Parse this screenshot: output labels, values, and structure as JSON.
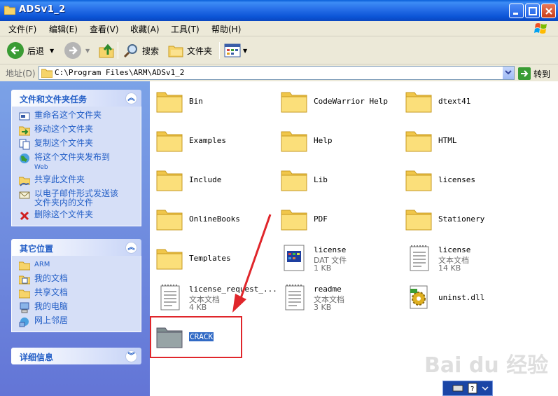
{
  "window": {
    "title": "ADSv1_2"
  },
  "menu": [
    "文件(F)",
    "编辑(E)",
    "查看(V)",
    "收藏(A)",
    "工具(T)",
    "帮助(H)"
  ],
  "toolbar": {
    "back": "后退",
    "search": "搜索",
    "folders": "文件夹"
  },
  "address": {
    "label": "地址(D)",
    "path": "C:\\Program Files\\ARM\\ADSv1_2",
    "go": "转到"
  },
  "tasks_panel": {
    "title": "文件和文件夹任务",
    "items": [
      {
        "label": "重命名这个文件夹"
      },
      {
        "label": "移动这个文件夹"
      },
      {
        "label": "复制这个文件夹"
      },
      {
        "label": "将这个文件夹发布到",
        "label2": "Web"
      },
      {
        "label": "共享此文件夹"
      },
      {
        "label": "以电子邮件形式发送该",
        "label2": "文件夹内的文件"
      },
      {
        "label": "删除这个文件夹"
      }
    ]
  },
  "places_panel": {
    "title": "其它位置",
    "items": [
      "ARM",
      "我的文档",
      "共享文档",
      "我的电脑",
      "网上邻居"
    ]
  },
  "details_panel": {
    "title": "详细信息"
  },
  "files": [
    {
      "name": "Bin",
      "type": "folder"
    },
    {
      "name": "CodeWarrior Help",
      "type": "folder"
    },
    {
      "name": "dtext41",
      "type": "folder"
    },
    {
      "name": "Examples",
      "type": "folder"
    },
    {
      "name": "Help",
      "type": "folder"
    },
    {
      "name": "HTML",
      "type": "folder"
    },
    {
      "name": "Include",
      "type": "folder"
    },
    {
      "name": "Lib",
      "type": "folder"
    },
    {
      "name": "licenses",
      "type": "folder"
    },
    {
      "name": "OnlineBooks",
      "type": "folder"
    },
    {
      "name": "PDF",
      "type": "folder"
    },
    {
      "name": "Stationery",
      "type": "folder"
    },
    {
      "name": "Templates",
      "type": "folder"
    },
    {
      "name": "license",
      "type": "dat",
      "line2": "DAT 文件",
      "line3": "1 KB"
    },
    {
      "name": "license",
      "type": "txt",
      "line2": "文本文档",
      "line3": "14 KB"
    },
    {
      "name": "license_request_...",
      "type": "txt",
      "line2": "文本文档",
      "line3": "4 KB"
    },
    {
      "name": "readme",
      "type": "txt",
      "line2": "文本文档",
      "line3": "3 KB"
    },
    {
      "name": "uninst.dll",
      "type": "dll"
    },
    {
      "name": "CRACK",
      "type": "folder-selected"
    }
  ],
  "watermark": "Bai du 经验",
  "colors": {
    "title_bar": "#0a54d6",
    "left_pane": "#7ba2e7",
    "link": "#215dc6",
    "annotation": "#e0262b",
    "selection": "#316ac5"
  }
}
